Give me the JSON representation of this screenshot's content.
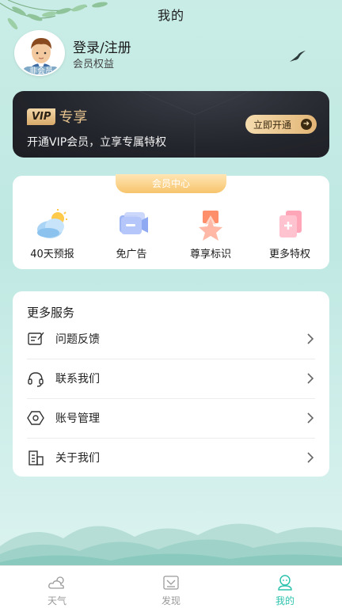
{
  "header": {
    "title": "我的"
  },
  "profile": {
    "login_label": "登录/注册",
    "benefits_label": "会员权益",
    "badge": "非会员"
  },
  "vip": {
    "tag": "VIP",
    "title": "专享",
    "description": "开通VIP会员，立享专属特权",
    "button_label": "立即开通"
  },
  "member_center": {
    "tab_label": "会员中心",
    "items": [
      {
        "label": "40天预报",
        "icon": "weather-cloud-sun-icon"
      },
      {
        "label": "免广告",
        "icon": "no-ads-icon"
      },
      {
        "label": "尊享标识",
        "icon": "star-badge-icon"
      },
      {
        "label": "更多特权",
        "icon": "more-privileges-icon"
      }
    ]
  },
  "services": {
    "title": "更多服务",
    "items": [
      {
        "label": "问题反馈",
        "icon": "feedback-icon"
      },
      {
        "label": "联系我们",
        "icon": "headset-icon"
      },
      {
        "label": "账号管理",
        "icon": "hexagon-settings-icon"
      },
      {
        "label": "关于我们",
        "icon": "building-icon"
      }
    ]
  },
  "tabbar": {
    "items": [
      {
        "label": "天气",
        "icon": "weather-icon"
      },
      {
        "label": "发现",
        "icon": "discover-icon"
      },
      {
        "label": "我的",
        "icon": "profile-icon"
      }
    ],
    "active_index": 2
  },
  "colors": {
    "accent": "#2ec3ae",
    "vip_gold": "#e8c58f",
    "vip_card_bg": "#23252c",
    "background": "#c9ece6"
  }
}
